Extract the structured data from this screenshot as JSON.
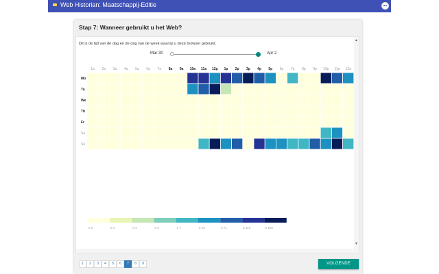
{
  "app": {
    "title": "Web Historian: Maatschappij-Editie"
  },
  "step": {
    "title": "Stap 7: Wanneer gebruikt u het Web?"
  },
  "description": "Dit is de tijd van de dag en de dag van de week waarop u deze browser gebruikt.",
  "date_range": {
    "start": "Mar 30",
    "end": "Apr 2"
  },
  "colors": {
    "topbar": "#3f51b5",
    "accent": "#009688",
    "scale": [
      "#ffffdd",
      "#e8f5b4",
      "#c4e7b4",
      "#7fcdbb",
      "#41b6c4",
      "#1d91c0",
      "#225ea8",
      "#253494",
      "#081d58"
    ]
  },
  "chart_data": {
    "type": "heatmap",
    "x_labels": [
      "1a",
      "2a",
      "3a",
      "4a",
      "5a",
      "6a",
      "7a",
      "8a",
      "9a",
      "10a",
      "11a",
      "12p",
      "1p",
      "2p",
      "3p",
      "4p",
      "5p",
      "6p",
      "7p",
      "8p",
      "9p",
      "10p",
      "11p",
      "12a"
    ],
    "x_bold": [
      false,
      false,
      false,
      false,
      false,
      false,
      false,
      true,
      true,
      true,
      true,
      true,
      true,
      true,
      true,
      true,
      true,
      false,
      false,
      false,
      false,
      false,
      false,
      false
    ],
    "y_labels": [
      "Mo",
      "Tu",
      "We",
      "Th",
      "Fr",
      "Sa",
      "Su"
    ],
    "y_bold": [
      true,
      true,
      true,
      true,
      true,
      false,
      false
    ],
    "values": [
      [
        0,
        0,
        0,
        0,
        0,
        0,
        0,
        0,
        0,
        113,
        113,
        20,
        113,
        71,
        155,
        71,
        20,
        0,
        7,
        0,
        0,
        155,
        71,
        20
      ],
      [
        0,
        0,
        0,
        0,
        0,
        0,
        0,
        0,
        0,
        20,
        71,
        155,
        4,
        0,
        0,
        0,
        0,
        0,
        0,
        0,
        0,
        0,
        0,
        0
      ],
      [
        0,
        0,
        0,
        0,
        0,
        0,
        0,
        0,
        0,
        0,
        0,
        0,
        0,
        0,
        0,
        0,
        0,
        0,
        0,
        0,
        0,
        0,
        0,
        0
      ],
      [
        0,
        0,
        0,
        0,
        0,
        0,
        0,
        0,
        0,
        0,
        0,
        0,
        0,
        0,
        0,
        0,
        0,
        0,
        0,
        0,
        0,
        0,
        0,
        0
      ],
      [
        0,
        0,
        0,
        0,
        0,
        0,
        0,
        0,
        0,
        0,
        0,
        0,
        0,
        0,
        0,
        0,
        0,
        0,
        0,
        0,
        0,
        0,
        0,
        0
      ],
      [
        0,
        0,
        0,
        0,
        0,
        0,
        0,
        0,
        0,
        0,
        0,
        0,
        0,
        0,
        0,
        0,
        0,
        0,
        0,
        0,
        0,
        7,
        20,
        0
      ],
      [
        0,
        0,
        0,
        0,
        0,
        0,
        0,
        0,
        0,
        0,
        7,
        155,
        20,
        71,
        0,
        113,
        20,
        20,
        7,
        7,
        71,
        20,
        155,
        7
      ]
    ],
    "legend": {
      "thresholds": [
        0,
        2,
        4,
        5,
        7,
        20,
        71,
        113,
        155
      ],
      "labels": [
        "≥ 0",
        "≥ 2",
        "≥ 4",
        "≥ 5",
        "≥ 7",
        "≥ 20",
        "≥ 71",
        "≥ 113",
        "≥ 155"
      ]
    }
  },
  "pagination": {
    "pages": [
      "1",
      "2",
      "3",
      "4",
      "5",
      "6",
      "7",
      "8",
      "9"
    ],
    "active": "7"
  },
  "next_button": {
    "label": "VOLGENDE"
  }
}
